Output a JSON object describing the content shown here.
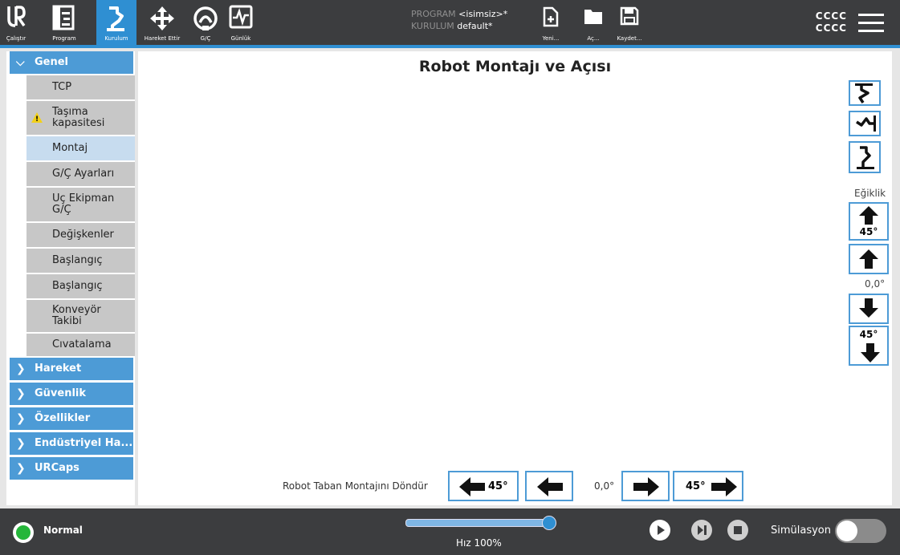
{
  "nav": [
    {
      "label": "Çalıştır",
      "icon": "ur-logo-icon"
    },
    {
      "label": "Program",
      "icon": "program-icon"
    },
    {
      "label": "Kurulum",
      "icon": "installation-icon",
      "active": true
    },
    {
      "label": "Hareket Ettir",
      "icon": "move-icon"
    },
    {
      "label": "G/Ç",
      "icon": "io-icon"
    },
    {
      "label": "Günlük",
      "icon": "log-icon"
    }
  ],
  "program": {
    "program_key": "PROGRAM",
    "program_val": "<isimsiz>*",
    "install_key": "KURULUM",
    "install_val": "default*"
  },
  "file": {
    "new": "Yeni...",
    "open": "Aç...",
    "save": "Kaydet..."
  },
  "user": {
    "line1": "CCCC",
    "line2": "CCCC"
  },
  "sidebar": {
    "sections": [
      "Genel",
      "Hareket",
      "Güvenlik",
      "Özellikler",
      "Endüstriyel Ha...",
      "URCaps"
    ],
    "items": [
      "TCP",
      "Taşıma kapasitesi",
      "Montaj",
      "G/Ç Ayarları",
      "Uç Ekipman G/Ç",
      "Değişkenler",
      "Başlangıç",
      "Başlangıç",
      "Konveyör Takibi",
      "Cıvatalama"
    ]
  },
  "main": {
    "title": "Robot Montajı ve Açısı",
    "tilt_label": "Eğiklik",
    "tilt_big_up": "45°",
    "tilt_value": "0,0°",
    "tilt_big_down": "45°",
    "rotate_label": "Robot Taban Montajını Döndür",
    "rotate_big_left": "45°",
    "rotate_value": "0,0°",
    "rotate_big_right": "45°"
  },
  "status": {
    "text": "Normal",
    "speed_label": "Hız 100%",
    "speed_fraction": 1.0,
    "simulation_label": "Simülasyon"
  },
  "colors": {
    "accent": "#2f8fd2",
    "bar": "#3c3d3f",
    "status_ok": "#25b63a"
  }
}
